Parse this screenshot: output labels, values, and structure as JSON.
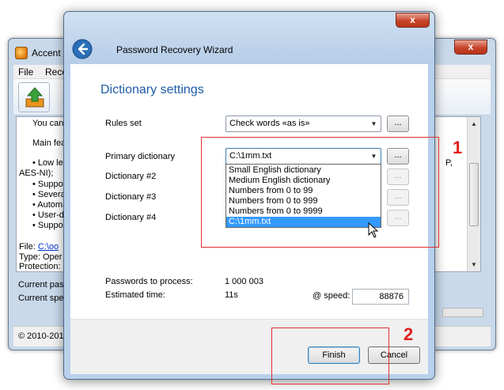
{
  "background_window": {
    "title": "Accent O",
    "close_glyph": "x",
    "menu": [
      "File",
      "Reco"
    ],
    "text_lines": [
      "You can fi",
      "Main featu",
      "• Low leve",
      "AES-NI);",
      "• Support",
      "• Several",
      "• Automat",
      "• User-def",
      "• Supports"
    ],
    "right_fragment": "P,",
    "file_label": "File:",
    "file_link": "C:\\oo",
    "type_text": "Type: Oper",
    "protection_text": "Protection:",
    "status_1": "Current pas",
    "status_2": "Current spe",
    "copyright": "© 2010-201"
  },
  "wizard": {
    "title": "Password Recovery Wizard",
    "close_glyph": "x",
    "heading": "Dictionary settings",
    "rules_label": "Rules set",
    "rules_value": "Check words «as is»",
    "primary_label": "Primary dictionary",
    "primary_value": "C:\\1mm.txt",
    "dict2_label": "Dictionary #2",
    "dict3_label": "Dictionary #3",
    "dict4_label": "Dictionary #4",
    "browse_label": "...",
    "dropdown_options": [
      "Small English dictionary",
      "Medium English dictionary",
      "Numbers from 0 to 99",
      "Numbers from 0 to 999",
      "Numbers from 0 to 9999",
      "C:\\1mm.txt"
    ],
    "selected_option_index": 5,
    "passwords_label": "Passwords to process:",
    "passwords_value": "1 000 003",
    "time_label": "Estimated time:",
    "time_value": "11s",
    "speed_label": "@ speed:",
    "speed_value": "88876",
    "finish_label": "Finish",
    "cancel_label": "Cancel"
  },
  "annotations": {
    "marker_1": "1",
    "marker_2": "2",
    "color": "#e03030"
  }
}
